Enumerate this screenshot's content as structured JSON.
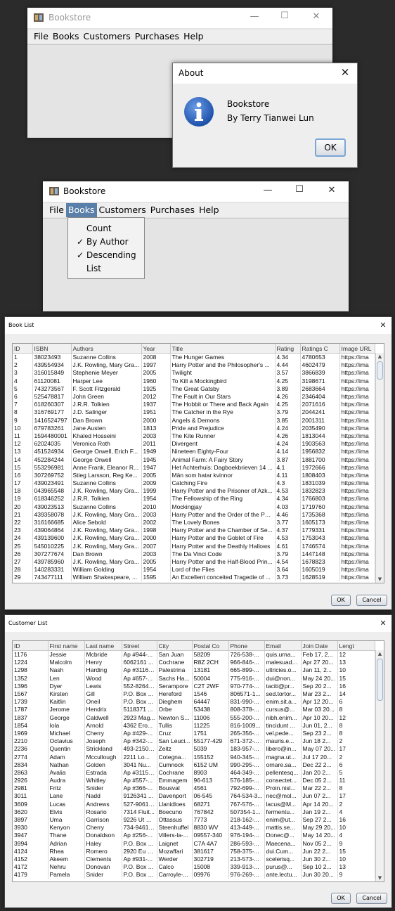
{
  "window1": {
    "title": "Bookstore",
    "menu": [
      "File",
      "Books",
      "Customers",
      "Purchases",
      "Help"
    ],
    "controls": {
      "minimize": "—",
      "maximize": "☐",
      "close": "✕"
    }
  },
  "about": {
    "title": "About",
    "close": "✕",
    "app_name": "Bookstore",
    "author": "By Terry Tianwei Lun",
    "ok": "OK"
  },
  "window2": {
    "title": "Bookstore",
    "menu": [
      "File",
      "Books",
      "Customers",
      "Purchases",
      "Help"
    ],
    "controls": {
      "minimize": "—",
      "maximize": "☐",
      "close": "✕"
    },
    "books_menu": [
      {
        "label": "Count",
        "checked": false
      },
      {
        "label": "By Author",
        "checked": true
      },
      {
        "label": "Descending",
        "checked": true
      },
      {
        "label": "List",
        "checked": false
      }
    ],
    "check_mark": "✓"
  },
  "book_list": {
    "title": "Book List",
    "close": "✕",
    "columns": [
      "ID",
      "ISBN",
      "Authors",
      "Year",
      "Title",
      "Rating",
      "Ratings C",
      "Image URL"
    ],
    "rows": [
      [
        "1",
        "38023493",
        "Suzanne Collins",
        "2008",
        "The Hunger Games",
        "4.34",
        "4780653",
        "https://ima"
      ],
      [
        "2",
        "439554934",
        "J.K. Rowling, Mary Gra...",
        "1997",
        "Harry Potter and the Philosopher's ...",
        "4.44",
        "4602479",
        "https://ima"
      ],
      [
        "3",
        "316015849",
        "Stephenie Meyer",
        "2005",
        "Twilight",
        "3.57",
        "3866839",
        "https://ima"
      ],
      [
        "4",
        "61120081",
        "Harper Lee",
        "1960",
        "To Kill a Mockingbird",
        "4.25",
        "3198671",
        "https://ima"
      ],
      [
        "5",
        "743273567",
        "F. Scott Fitzgerald",
        "1925",
        "The Great Gatsby",
        "3.89",
        "2683664",
        "https://ima"
      ],
      [
        "6",
        "525478817",
        "John Green",
        "2012",
        "The Fault in Our Stars",
        "4.26",
        "2346404",
        "https://ima"
      ],
      [
        "7",
        "618260307",
        "J.R.R. Tolkien",
        "1937",
        "The Hobbit or There and Back Again",
        "4.25",
        "2071616",
        "https://ima"
      ],
      [
        "8",
        "316769177",
        "J.D. Salinger",
        "1951",
        "The Catcher in the Rye",
        "3.79",
        "2044241",
        "https://ima"
      ],
      [
        "9",
        "1416524797",
        "Dan Brown",
        "2000",
        "Angels & Demons",
        "3.85",
        "2001311",
        "https://ima"
      ],
      [
        "10",
        "679783261",
        "Jane Austen",
        "1813",
        "Pride and Prejudice",
        "4.24",
        "2035490",
        "https://ima"
      ],
      [
        "11",
        "1594480001",
        "Khaled Hosseini",
        "2003",
        "The Kite Runner",
        "4.26",
        "1813044",
        "https://ima"
      ],
      [
        "12",
        "62024035",
        "Veronica Roth",
        "2011",
        "Divergent",
        "4.24",
        "1903563",
        "https://ima"
      ],
      [
        "13",
        "451524934",
        "George Orwell, Erich F...",
        "1949",
        "Nineteen Eighty-Four",
        "4.14",
        "1956832",
        "https://ima"
      ],
      [
        "14",
        "452284244",
        "George Orwell",
        "1945",
        "Animal Farm: A Fairy Story",
        "3.87",
        "1881700",
        "https://ima"
      ],
      [
        "15",
        "553296981",
        "Anne Frank, Eleanor R...",
        "1947",
        "Het Achterhuis: Dagboekbrieven 14 ...",
        "4.1",
        "1972666",
        "https://ima"
      ],
      [
        "16",
        "307269752",
        "Stieg Larsson, Reg Ke...",
        "2005",
        "Män som hatar kvinnor",
        "4.11",
        "1808403",
        "https://ima"
      ],
      [
        "17",
        "439023491",
        "Suzanne Collins",
        "2009",
        "Catching Fire",
        "4.3",
        "1831039",
        "https://ima"
      ],
      [
        "18",
        "043965548",
        "J.K. Rowling, Mary Gra...",
        "1999",
        "Harry Potter and the Prisoner of Azk...",
        "4.53",
        "1832823",
        "https://ima"
      ],
      [
        "19",
        "618346252",
        "J.R.R. Tolkien",
        "1954",
        "The Fellowship of the Ring",
        "4.34",
        "1766803",
        "https://ima"
      ],
      [
        "20",
        "439023513",
        "Suzanne Collins",
        "2010",
        "Mockingjay",
        "4.03",
        "1719760",
        "https://ima"
      ],
      [
        "21",
        "439358078",
        "J.K. Rowling, Mary Gra...",
        "2003",
        "Harry Potter and the Order of the Ph...",
        "4.46",
        "1735368",
        "https://ima"
      ],
      [
        "22",
        "316166685",
        "Alice Sebold",
        "2002",
        "The Lovely Bones",
        "3.77",
        "1605173",
        "https://ima"
      ],
      [
        "23",
        "439064864",
        "J.K. Rowling, Mary Gra...",
        "1998",
        "Harry Potter and the Chamber of Se...",
        "4.37",
        "1779331",
        "https://ima"
      ],
      [
        "24",
        "439139600",
        "J.K. Rowling, Mary Gra...",
        "2000",
        "Harry Potter and the Goblet of Fire",
        "4.53",
        "1753043",
        "https://ima"
      ],
      [
        "25",
        "545010225",
        "J.K. Rowling, Mary Gra...",
        "2007",
        "Harry Potter and the Deathly Hallows",
        "4.61",
        "1746574",
        "https://ima"
      ],
      [
        "26",
        "307277674",
        "Dan Brown",
        "2003",
        "The Da Vinci Code",
        "3.79",
        "1447148",
        "https://ima"
      ],
      [
        "27",
        "439785960",
        "J.K. Rowling, Mary Gra...",
        "2005",
        "Harry Potter and the Half-Blood Prin...",
        "4.54",
        "1678823",
        "https://ima"
      ],
      [
        "28",
        "140283331",
        "William Golding",
        "1954",
        "Lord of the Flies",
        "3.64",
        "1605019",
        "https://ima"
      ],
      [
        "29",
        "743477111",
        "William Shakespeare, ...",
        "1595",
        "An Excellent conceited Tragedie of ...",
        "3.73",
        "1628519",
        "https://ima"
      ]
    ],
    "ok": "OK",
    "cancel": "Cancel"
  },
  "customer_list": {
    "title": "Customer List",
    "close": "✕",
    "columns": [
      "ID",
      "First name",
      "Last name",
      "Street",
      "City",
      "Postal Co",
      "Phone",
      "Email",
      "Join Date",
      "Lengt"
    ],
    "rows": [
      [
        "1176",
        "Jessie",
        "Mcbride",
        "Ap #944-...",
        "San Juan",
        "58209",
        "726-538-...",
        "quis.urna...",
        "Feb 17, 2...",
        "12"
      ],
      [
        "1224",
        "Malcolm",
        "Henry",
        "6062161 ...",
        "Cochrane",
        "R8Z 2CH",
        "966-846-...",
        "malesuada...",
        "Apr 27 20...",
        "13"
      ],
      [
        "1298",
        "Nash",
        "Harding",
        "Ap #3116-...",
        "Palestrina",
        "13181",
        "665-899-...",
        "ultricies.o...",
        "Jan 11, 2...",
        "10"
      ],
      [
        "1352",
        "Len",
        "Wood",
        "Ap #657-...",
        "Sachs Ha...",
        "50004",
        "775-916-...",
        "dui@non...",
        "May 24 20...",
        "15"
      ],
      [
        "1396",
        "Dyer",
        "Lewis",
        "552-8264 ...",
        "Serampore",
        "C2T 2WF",
        "970-774-...",
        "taciti@pr...",
        "Sep 20 2...",
        "16"
      ],
      [
        "1567",
        "Kirsten",
        "Gill",
        "P.O. Box ...",
        "Hereford",
        "1546",
        "806571-1...",
        "sed.tortor...",
        "Mar 23 2...",
        "14"
      ],
      [
        "1739",
        "Kaitlin",
        "Oneil",
        "P.O. Box ...",
        "Dieghem",
        "64447",
        "831-990-...",
        "enim.sit.a...",
        "Apr 12 20...",
        "6"
      ],
      [
        "1787",
        "Jerome",
        "Hendrix",
        "5118371 ...",
        "Orbe",
        "53438",
        "808-378-...",
        "cursus@...",
        "Mar 03 20...",
        "8"
      ],
      [
        "1837",
        "George",
        "Caldwell",
        "2923 Mag...",
        "Newton S...",
        "11006",
        "555-200-...",
        "nibh.enim...",
        "Apr 10 20...",
        "12"
      ],
      [
        "1854",
        "Iola",
        "Arnold",
        "4362 Ero...",
        "Tullis",
        "11225",
        "816-1009...",
        "tincidunt ...",
        "Jun 01, 2...",
        "8"
      ],
      [
        "1969",
        "Michael",
        "Cherry",
        "Ap #429-...",
        "Cruz",
        "1751",
        "265-356-...",
        "vel.pede...",
        "Sep 23 2...",
        "8"
      ],
      [
        "2210",
        "Octavius",
        "Joseph",
        "Ap #342-...",
        "San Leuci...",
        "55177-429",
        "671-372-...",
        "mauris.e...",
        "Jun 18 2...",
        "2"
      ],
      [
        "2236",
        "Quentin",
        "Strickland",
        "493-2150 ...",
        "Zeitz",
        "5039",
        "183-957-...",
        "libero@in...",
        "May 07 20...",
        "17"
      ],
      [
        "2774",
        "Adam",
        "Mccullough",
        "2211 Lo...",
        "Cotegna...",
        "155152",
        "940-345-...",
        "magna.ut...",
        "Jul 17 20...",
        "2"
      ],
      [
        "2834",
        "Nathan",
        "Golden",
        "3041 Nu...",
        "Cumnock",
        "6152 UM",
        "990-295-...",
        "ornare.sa...",
        "Dec 22 2...",
        "6"
      ],
      [
        "2863",
        "Avalia",
        "Estrada",
        "Ap #3115-...",
        "Cochrane",
        "8903",
        "464-349-...",
        "pellentesq...",
        "Jan 20 2...",
        "5"
      ],
      [
        "2926",
        "Audra",
        "Whitley",
        "Ap #557-...",
        "Emmagem",
        "96-613",
        "576-185-...",
        "consectet...",
        "Dec 05 2...",
        "11"
      ],
      [
        "2981",
        "Fritz",
        "Snider",
        "Ap #366-...",
        "Bousval",
        "4561",
        "792-699-...",
        "Proin.nisl...",
        "Mar 22 2...",
        "8"
      ],
      [
        "3011",
        "Lane",
        "Nadd",
        "9126341 ...",
        "Davenport",
        "06-545",
        "764-534-3...",
        "nec@mol...",
        "Jun 07 2...",
        "17"
      ],
      [
        "3609",
        "Lucas",
        "Andrews",
        "527-9061 ...",
        "Llanidloes",
        "68271",
        "767-576-...",
        "lacus@M...",
        "Apr 14 20...",
        "2"
      ],
      [
        "3620",
        "Elvis",
        "Rosario",
        "7314 Fluit...",
        "Boecuno",
        "767842",
        "507354-1...",
        "fermentu...",
        "Jan 19 2...",
        "4"
      ],
      [
        "3897",
        "Uma",
        "Garrison",
        "9226 Ut R...",
        "Ottassus",
        "7773",
        "218-162-...",
        "enim@ut...",
        "Sep 27 2...",
        "16"
      ],
      [
        "3930",
        "Kenyon",
        "Cherry",
        "734-9461 ...",
        "Steenhuffel",
        "8830 WV",
        "413-449-...",
        "mattis.se...",
        "May 29 20...",
        "10"
      ],
      [
        "3947",
        "Thane",
        "Donaldson",
        "Ap #256-...",
        "Villers-la-...",
        "09557-340",
        "976-194-...",
        "Donec@...",
        "May 14 20...",
        "4"
      ],
      [
        "3994",
        "Adrian",
        "Haley",
        "P.O. Box ...",
        "Laignet",
        "C7A 4A7",
        "286-593-...",
        "Maecena...",
        "Nov 05 2...",
        "9"
      ],
      [
        "4124",
        "Rhea",
        "Romero",
        "2920 Eu St...",
        "Mozaffari",
        "381617",
        "758-375-...",
        "dui.Cum...",
        "Jun 22 2...",
        "15"
      ],
      [
        "4152",
        "Akeem",
        "Clements",
        "Ap #931-...",
        "Werder",
        "302719",
        "213-573-...",
        "scelerisq...",
        "Jun 30 2...",
        "10"
      ],
      [
        "4172",
        "Nehru",
        "Donovan",
        "P.O. Box ...",
        "Calco",
        "15008",
        "339-913-...",
        "purus@...",
        "Sep 10 2...",
        "13"
      ],
      [
        "4179",
        "Pamela",
        "Snider",
        "P.O. Box ...",
        "Carroyle-...",
        "09976",
        "976-269-...",
        "ante.lectu...",
        "Jun 30 20...",
        "9"
      ]
    ],
    "ok": "OK",
    "cancel": "Cancel"
  }
}
